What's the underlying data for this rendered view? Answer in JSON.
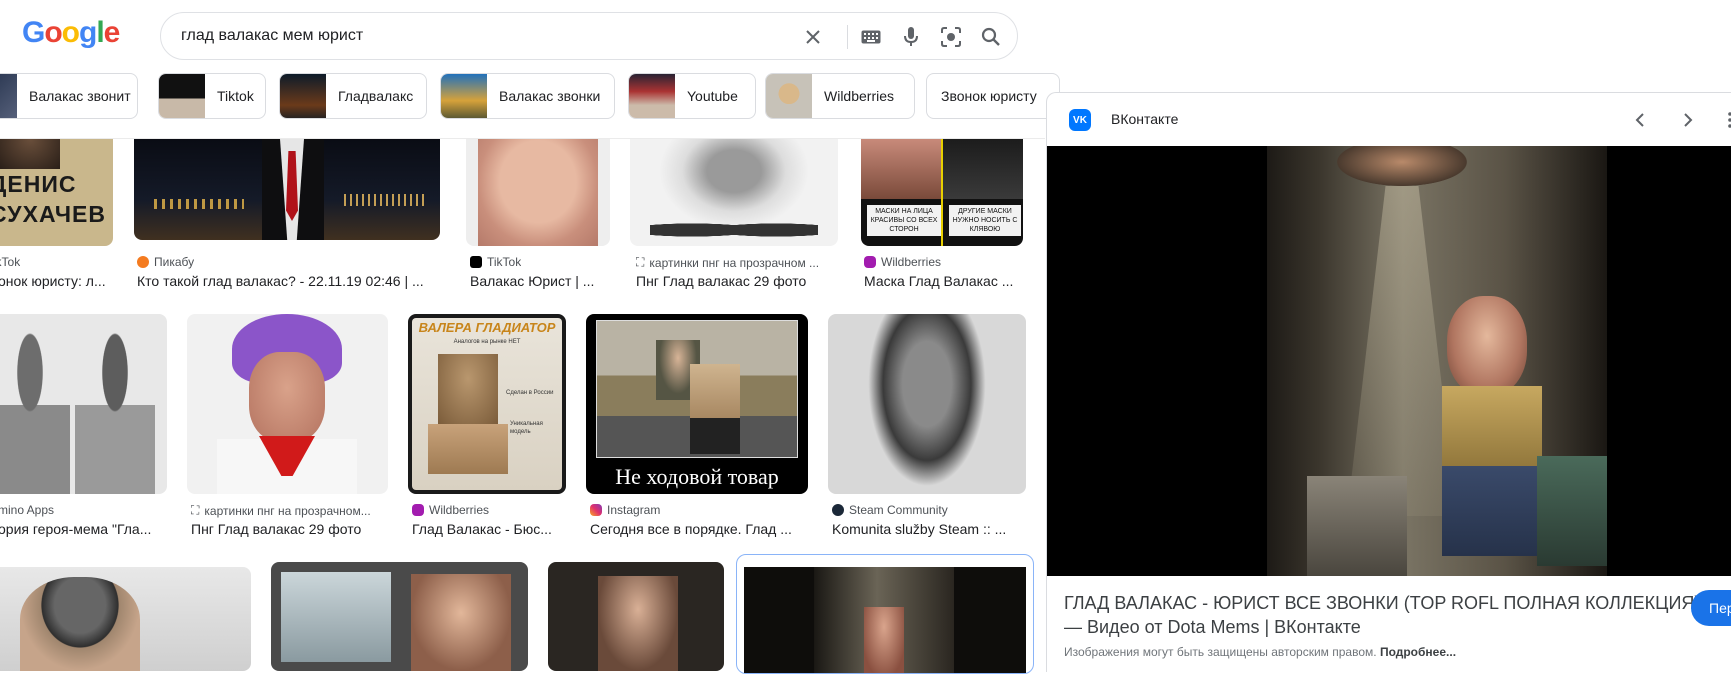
{
  "logo": "Google",
  "search": {
    "query": "глад валакас мем юрист"
  },
  "chips": [
    {
      "label": "Валакас звонит"
    },
    {
      "label": "Tiktok"
    },
    {
      "label": "Гладвалакс"
    },
    {
      "label": "Валакас звонки"
    },
    {
      "label": "Youtube"
    },
    {
      "label": "Wildberries"
    },
    {
      "label": "Звонок юристу"
    }
  ],
  "row1": [
    {
      "source": "TikTok",
      "title": "онок юристу: л...",
      "img_text": "ДЕНИС СУХАЧЕВ"
    },
    {
      "source": "Пикабу",
      "title": "Кто такой глад валакас? - 22.11.19 02:46 | ..."
    },
    {
      "source": "TikTok",
      "title": "Валакас Юрист | ..."
    },
    {
      "source": "картинки пнг на прозрачном ...",
      "title": "Пнг Глад валакас 29 фото"
    },
    {
      "source": "Wildberries",
      "title": "Маска Глад Валакас ...",
      "img_text_1": "МАСКИ НА ЛИЦА КРАСИВЫ СО ВСЕХ СТОРОН",
      "img_text_2": "ДРУГИЕ МАСКИ НУЖНО НОСИТЬ С КЛЯВОЮ"
    }
  ],
  "row2": [
    {
      "source": "mino Apps",
      "title": "ория героя-мема \"Гла..."
    },
    {
      "source": "картинки пнг на прозрачном...",
      "title": "Пнг Глад валакас 29 фото"
    },
    {
      "source": "Wildberries",
      "title": "Глад Валакас - Бюс...",
      "img_title": "ВАЛЕРА ГЛАДИАТОР",
      "img_sub": "Аналогов на рынке НЕТ",
      "img_made": "Сделан в России",
      "img_unique": "Уникальная модель"
    },
    {
      "source": "Instagram",
      "title": "Сегодня все в порядке. Глад ...",
      "img_caption": "Не ходовой товар"
    },
    {
      "source": "Steam Community",
      "title": "Komunita služby Steam :: ..."
    }
  ],
  "panel": {
    "site": "ВКонтакте",
    "title": "ГЛАД ВАЛАКАС - ЮРИСТ ВСЕ ЗВОНКИ (TOP ROFL ПОЛНАЯ КОЛЛЕКЦИЯ) — Видео от Dota Mems | ВКонтакте",
    "note": "Изображения могут быть защищены авторским правом.",
    "note_more": "Подробнее...",
    "visit_label": "Пер"
  },
  "colors": {
    "accent": "#1a73e8",
    "vk": "#0077ff"
  }
}
